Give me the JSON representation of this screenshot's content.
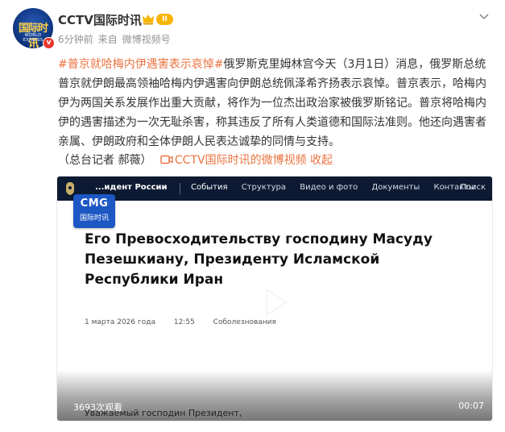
{
  "post": {
    "author": "CCTV国际时讯",
    "avatar_text_top": "国际时讯",
    "avatar_text_bottom": "WORLD EXPRESS",
    "verified_mark": "v",
    "level": "II",
    "time_ago": "6分钟前",
    "source_prefix": "来自",
    "source": "微博视频号",
    "topic": "#普京就哈梅内伊遇害表示哀悼#",
    "text": "俄罗斯克里姆林宫今天（3月1日）消息，俄罗斯总统普京就伊朗最高领袖哈梅内伊遇害向伊朗总统佩泽希齐扬表示哀悼。普京表示，哈梅内伊为两国关系发展作出重大贡献，将作为一位杰出政治家被俄罗斯铭记。普京将哈梅内伊的遇害描述为一次无耻杀害，称其违反了所有人类道德和国际法准则。他还向遇害者亲属、伊朗政府和全体伊朗人民表达诚挚的同情与支持。",
    "reporter": "（总台记者 郝薇）",
    "video_link": "CCTV国际时讯的微博视频",
    "collapse": "收起"
  },
  "video": {
    "nav_site": "...идент России",
    "nav_items": [
      "События",
      "Структура",
      "Видео и фото",
      "Документы",
      "Контакты"
    ],
    "nav_search": "Поиск",
    "cmg_logo": "CMG",
    "cmg_sub": "国际时讯",
    "doc_title": "Его Превосходительству господину Масуду Пезешкиану, Президенту Исламской Республики Иран",
    "doc_date": "1 марта 2026 года",
    "doc_time": "12:55",
    "doc_category": "Соболезнования",
    "doc_body_start": "Уважаемый господин Президент,",
    "views": "3693次观看",
    "duration": "00:07"
  },
  "colors": {
    "accent": "#eb7340",
    "nav_bg": "#0c1a33",
    "cmg_blue": "#1d57c4",
    "badge_gold": "#f7b500",
    "verified_red": "#e8372f"
  }
}
